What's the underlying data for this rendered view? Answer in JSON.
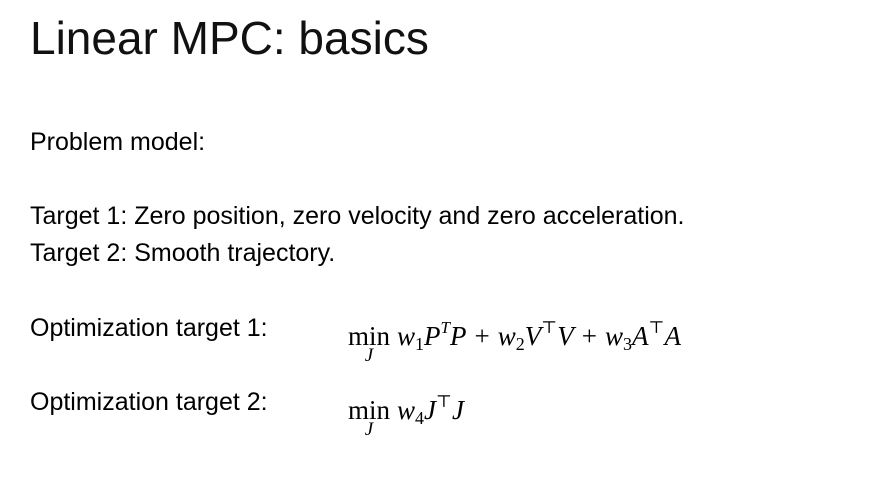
{
  "slide": {
    "title": "Linear MPC: basics",
    "problem_model": "Problem model:",
    "target1": "Target 1: Zero position, zero velocity and zero acceleration.",
    "target2": "Target 2: Smooth trajectory.",
    "opt_target1_label": "Optimization target 1:",
    "opt_target2_label": "Optimization target 2:"
  },
  "equations": {
    "eq1": {
      "min": "min",
      "min_sub": "J",
      "w1": "w",
      "w1_sub": "1",
      "P": "P",
      "P_sup": "T",
      "P2": "P",
      "plus1": "+",
      "w2": "w",
      "w2_sub": "2",
      "V": "V",
      "V_sup": "⊤",
      "V2": "V",
      "plus2": "+",
      "w3": "w",
      "w3_sub": "3",
      "A": "A",
      "A_sup": "⊤",
      "A2": "A"
    },
    "eq2": {
      "min": "min",
      "min_sub": "J",
      "w4": "w",
      "w4_sub": "4",
      "J": "J",
      "J_sup": "⊤",
      "J2": "J"
    }
  }
}
